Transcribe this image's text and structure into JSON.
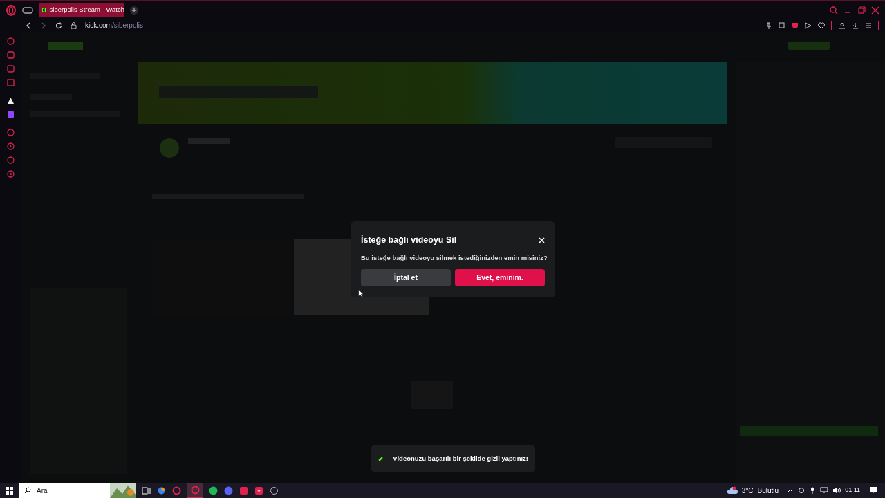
{
  "browser": {
    "tabs": [
      {
        "title": "siberpolis Stream - Watch",
        "selected": true
      }
    ],
    "address": {
      "domain": "kick.com",
      "path": "/siberpolis"
    }
  },
  "dialog": {
    "title": "İsteğe bağlı videoyu Sil",
    "message": "Bu isteğe bağlı videoyu silmek istediğinizden emin misiniz?",
    "buttons": [
      {
        "label": "İptal et",
        "kind": "secondary"
      },
      {
        "label": "Evet, eminim.",
        "kind": "primary"
      }
    ]
  },
  "toast": {
    "message": "Videonuzu başarılı bir şekilde gizli yaptınız!"
  },
  "taskbar": {
    "search_placeholder": "Ara",
    "temperature": "3°C",
    "weather": "Bulutlu",
    "time": "01:11"
  }
}
